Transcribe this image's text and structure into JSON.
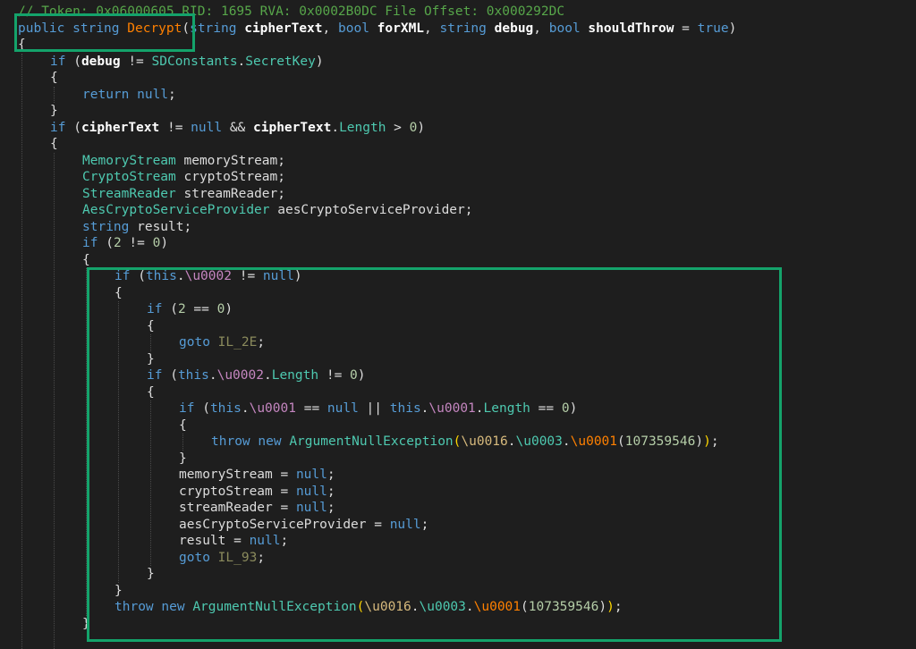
{
  "editor": {
    "lines": [
      {
        "indent": 0,
        "tokens": [
          {
            "t": "// Token: 0x06000605 RID: 1695 RVA: 0x0002B0DC File Offset: 0x000292DC",
            "c": "comment"
          }
        ]
      },
      {
        "indent": 0,
        "tokens": [
          {
            "t": "public",
            "c": "kw"
          },
          {
            "t": " ",
            "c": "plain"
          },
          {
            "t": "string",
            "c": "kw"
          },
          {
            "t": " ",
            "c": "plain"
          },
          {
            "t": "Decrypt",
            "c": "method"
          },
          {
            "t": "(",
            "c": "plain"
          },
          {
            "t": "string",
            "c": "kw"
          },
          {
            "t": " ",
            "c": "plain"
          },
          {
            "t": "cipherText",
            "c": "param"
          },
          {
            "t": ", ",
            "c": "plain"
          },
          {
            "t": "bool",
            "c": "kw"
          },
          {
            "t": " ",
            "c": "plain"
          },
          {
            "t": "forXML",
            "c": "param"
          },
          {
            "t": ", ",
            "c": "plain"
          },
          {
            "t": "string",
            "c": "kw"
          },
          {
            "t": " ",
            "c": "plain"
          },
          {
            "t": "debug",
            "c": "param"
          },
          {
            "t": ", ",
            "c": "plain"
          },
          {
            "t": "bool",
            "c": "kw"
          },
          {
            "t": " ",
            "c": "plain"
          },
          {
            "t": "shouldThrow",
            "c": "param"
          },
          {
            "t": " = ",
            "c": "plain"
          },
          {
            "t": "true",
            "c": "kw"
          },
          {
            "t": ")",
            "c": "plain"
          }
        ]
      },
      {
        "indent": 0,
        "tokens": [
          {
            "t": "{",
            "c": "brace"
          }
        ]
      },
      {
        "indent": 1,
        "tokens": [
          {
            "t": "if",
            "c": "kw"
          },
          {
            "t": " (",
            "c": "plain"
          },
          {
            "t": "debug",
            "c": "param"
          },
          {
            "t": " != ",
            "c": "plain"
          },
          {
            "t": "SDConstants",
            "c": "type"
          },
          {
            "t": ".",
            "c": "plain"
          },
          {
            "t": "SecretKey",
            "c": "prop"
          },
          {
            "t": ")",
            "c": "plain"
          }
        ]
      },
      {
        "indent": 1,
        "tokens": [
          {
            "t": "{",
            "c": "brace"
          }
        ]
      },
      {
        "indent": 2,
        "tokens": [
          {
            "t": "return",
            "c": "kw"
          },
          {
            "t": " ",
            "c": "plain"
          },
          {
            "t": "null",
            "c": "kw"
          },
          {
            "t": ";",
            "c": "plain"
          }
        ]
      },
      {
        "indent": 1,
        "tokens": [
          {
            "t": "}",
            "c": "brace"
          }
        ]
      },
      {
        "indent": 1,
        "tokens": [
          {
            "t": "if",
            "c": "kw"
          },
          {
            "t": " (",
            "c": "plain"
          },
          {
            "t": "cipherText",
            "c": "param"
          },
          {
            "t": " != ",
            "c": "plain"
          },
          {
            "t": "null",
            "c": "kw"
          },
          {
            "t": " && ",
            "c": "plain"
          },
          {
            "t": "cipherText",
            "c": "param"
          },
          {
            "t": ".",
            "c": "plain"
          },
          {
            "t": "Length",
            "c": "prop"
          },
          {
            "t": " > ",
            "c": "plain"
          },
          {
            "t": "0",
            "c": "num"
          },
          {
            "t": ")",
            "c": "plain"
          }
        ]
      },
      {
        "indent": 1,
        "tokens": [
          {
            "t": "{",
            "c": "brace"
          }
        ]
      },
      {
        "indent": 2,
        "tokens": [
          {
            "t": "MemoryStream",
            "c": "type"
          },
          {
            "t": " memoryStream;",
            "c": "plain"
          }
        ]
      },
      {
        "indent": 2,
        "tokens": [
          {
            "t": "CryptoStream",
            "c": "type"
          },
          {
            "t": " cryptoStream;",
            "c": "plain"
          }
        ]
      },
      {
        "indent": 2,
        "tokens": [
          {
            "t": "StreamReader",
            "c": "type"
          },
          {
            "t": " streamReader;",
            "c": "plain"
          }
        ]
      },
      {
        "indent": 2,
        "tokens": [
          {
            "t": "AesCryptoServiceProvider",
            "c": "type"
          },
          {
            "t": " aesCryptoServiceProvider;",
            "c": "plain"
          }
        ]
      },
      {
        "indent": 2,
        "tokens": [
          {
            "t": "string",
            "c": "kw"
          },
          {
            "t": " result;",
            "c": "plain"
          }
        ]
      },
      {
        "indent": 2,
        "tokens": [
          {
            "t": "if",
            "c": "kw"
          },
          {
            "t": " (",
            "c": "plain"
          },
          {
            "t": "2",
            "c": "num"
          },
          {
            "t": " != ",
            "c": "plain"
          },
          {
            "t": "0",
            "c": "num"
          },
          {
            "t": ")",
            "c": "plain"
          }
        ]
      },
      {
        "indent": 2,
        "tokens": [
          {
            "t": "{",
            "c": "brace"
          }
        ]
      },
      {
        "indent": 3,
        "tokens": [
          {
            "t": "if",
            "c": "kw"
          },
          {
            "t": " (",
            "c": "plain"
          },
          {
            "t": "this",
            "c": "kw"
          },
          {
            "t": ".",
            "c": "plain"
          },
          {
            "t": "\\u0002",
            "c": "field"
          },
          {
            "t": " != ",
            "c": "plain"
          },
          {
            "t": "null",
            "c": "kw"
          },
          {
            "t": ")",
            "c": "plain"
          }
        ]
      },
      {
        "indent": 3,
        "tokens": [
          {
            "t": "{",
            "c": "brace"
          }
        ]
      },
      {
        "indent": 4,
        "tokens": [
          {
            "t": "if",
            "c": "kw"
          },
          {
            "t": " (",
            "c": "plain"
          },
          {
            "t": "2",
            "c": "num"
          },
          {
            "t": " == ",
            "c": "plain"
          },
          {
            "t": "0",
            "c": "num"
          },
          {
            "t": ")",
            "c": "plain"
          }
        ]
      },
      {
        "indent": 4,
        "tokens": [
          {
            "t": "{",
            "c": "brace"
          }
        ]
      },
      {
        "indent": 5,
        "tokens": [
          {
            "t": "goto",
            "c": "kw"
          },
          {
            "t": " ",
            "c": "plain"
          },
          {
            "t": "IL_2E",
            "c": "label"
          },
          {
            "t": ";",
            "c": "plain"
          }
        ]
      },
      {
        "indent": 4,
        "tokens": [
          {
            "t": "}",
            "c": "brace"
          }
        ]
      },
      {
        "indent": 4,
        "tokens": [
          {
            "t": "if",
            "c": "kw"
          },
          {
            "t": " (",
            "c": "plain"
          },
          {
            "t": "this",
            "c": "kw"
          },
          {
            "t": ".",
            "c": "plain"
          },
          {
            "t": "\\u0002",
            "c": "field"
          },
          {
            "t": ".",
            "c": "plain"
          },
          {
            "t": "Length",
            "c": "prop"
          },
          {
            "t": " != ",
            "c": "plain"
          },
          {
            "t": "0",
            "c": "num"
          },
          {
            "t": ")",
            "c": "plain"
          }
        ]
      },
      {
        "indent": 4,
        "tokens": [
          {
            "t": "{",
            "c": "brace"
          }
        ]
      },
      {
        "indent": 5,
        "tokens": [
          {
            "t": "if",
            "c": "kw"
          },
          {
            "t": " (",
            "c": "plain"
          },
          {
            "t": "this",
            "c": "kw"
          },
          {
            "t": ".",
            "c": "plain"
          },
          {
            "t": "\\u0001",
            "c": "field"
          },
          {
            "t": " == ",
            "c": "plain"
          },
          {
            "t": "null",
            "c": "kw"
          },
          {
            "t": " || ",
            "c": "plain"
          },
          {
            "t": "this",
            "c": "kw"
          },
          {
            "t": ".",
            "c": "plain"
          },
          {
            "t": "\\u0001",
            "c": "field"
          },
          {
            "t": ".",
            "c": "plain"
          },
          {
            "t": "Length",
            "c": "prop"
          },
          {
            "t": " == ",
            "c": "plain"
          },
          {
            "t": "0",
            "c": "num"
          },
          {
            "t": ")",
            "c": "plain"
          }
        ]
      },
      {
        "indent": 5,
        "tokens": [
          {
            "t": "{",
            "c": "brace"
          }
        ]
      },
      {
        "indent": 6,
        "tokens": [
          {
            "t": "throw",
            "c": "kw"
          },
          {
            "t": " ",
            "c": "plain"
          },
          {
            "t": "new",
            "c": "kw"
          },
          {
            "t": " ",
            "c": "plain"
          },
          {
            "t": "ArgumentNullException",
            "c": "type"
          },
          {
            "t": "(",
            "c": "paren"
          },
          {
            "t": "\\u0016",
            "c": "cls"
          },
          {
            "t": ".",
            "c": "plain"
          },
          {
            "t": "\\u0003",
            "c": "type"
          },
          {
            "t": ".",
            "c": "plain"
          },
          {
            "t": "\\u0001",
            "c": "method"
          },
          {
            "t": "(",
            "c": "plain"
          },
          {
            "t": "107359546",
            "c": "num"
          },
          {
            "t": ")",
            "c": "plain"
          },
          {
            "t": ")",
            "c": "paren"
          },
          {
            "t": ";",
            "c": "plain"
          }
        ]
      },
      {
        "indent": 5,
        "tokens": [
          {
            "t": "}",
            "c": "brace"
          }
        ]
      },
      {
        "indent": 5,
        "tokens": [
          {
            "t": "memoryStream = ",
            "c": "plain"
          },
          {
            "t": "null",
            "c": "kw"
          },
          {
            "t": ";",
            "c": "plain"
          }
        ]
      },
      {
        "indent": 5,
        "tokens": [
          {
            "t": "cryptoStream = ",
            "c": "plain"
          },
          {
            "t": "null",
            "c": "kw"
          },
          {
            "t": ";",
            "c": "plain"
          }
        ]
      },
      {
        "indent": 5,
        "tokens": [
          {
            "t": "streamReader = ",
            "c": "plain"
          },
          {
            "t": "null",
            "c": "kw"
          },
          {
            "t": ";",
            "c": "plain"
          }
        ]
      },
      {
        "indent": 5,
        "tokens": [
          {
            "t": "aesCryptoServiceProvider = ",
            "c": "plain"
          },
          {
            "t": "null",
            "c": "kw"
          },
          {
            "t": ";",
            "c": "plain"
          }
        ]
      },
      {
        "indent": 5,
        "tokens": [
          {
            "t": "result = ",
            "c": "plain"
          },
          {
            "t": "null",
            "c": "kw"
          },
          {
            "t": ";",
            "c": "plain"
          }
        ]
      },
      {
        "indent": 5,
        "tokens": [
          {
            "t": "goto",
            "c": "kw"
          },
          {
            "t": " ",
            "c": "plain"
          },
          {
            "t": "IL_93",
            "c": "label"
          },
          {
            "t": ";",
            "c": "plain"
          }
        ]
      },
      {
        "indent": 4,
        "tokens": [
          {
            "t": "}",
            "c": "brace"
          }
        ]
      },
      {
        "indent": 3,
        "tokens": [
          {
            "t": "}",
            "c": "brace"
          }
        ]
      },
      {
        "indent": 3,
        "tokens": [
          {
            "t": "throw",
            "c": "kw"
          },
          {
            "t": " ",
            "c": "plain"
          },
          {
            "t": "new",
            "c": "kw"
          },
          {
            "t": " ",
            "c": "plain"
          },
          {
            "t": "ArgumentNullException",
            "c": "type"
          },
          {
            "t": "(",
            "c": "paren"
          },
          {
            "t": "\\u0016",
            "c": "cls"
          },
          {
            "t": ".",
            "c": "plain"
          },
          {
            "t": "\\u0003",
            "c": "type"
          },
          {
            "t": ".",
            "c": "plain"
          },
          {
            "t": "\\u0001",
            "c": "method"
          },
          {
            "t": "(",
            "c": "plain"
          },
          {
            "t": "107359546",
            "c": "num"
          },
          {
            "t": ")",
            "c": "plain"
          },
          {
            "t": ")",
            "c": "paren"
          },
          {
            "t": ";",
            "c": "plain"
          }
        ]
      },
      {
        "indent": 2,
        "tokens": [
          {
            "t": "}",
            "c": "brace"
          }
        ]
      }
    ]
  },
  "colors": {
    "background": "#1e1e1e",
    "highlight_box": "#14a36b"
  }
}
